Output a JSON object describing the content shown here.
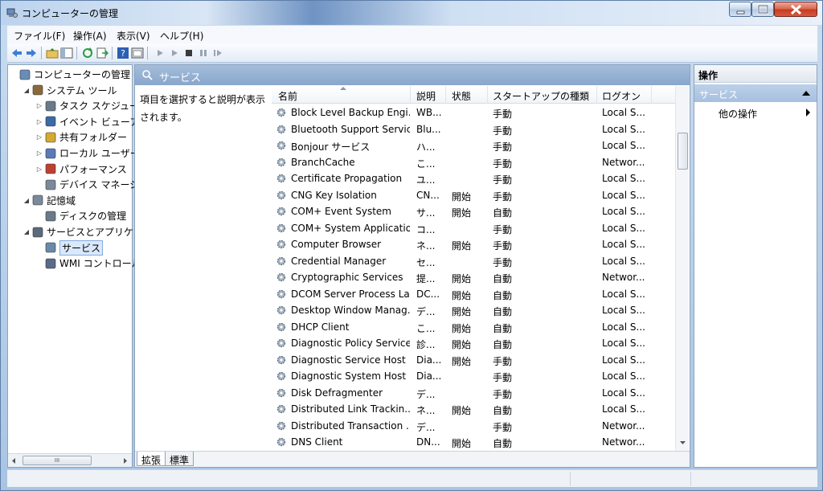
{
  "window": {
    "title": "コンピューターの管理"
  },
  "menu": [
    {
      "label": "ファイル(F)"
    },
    {
      "label": "操作(A)"
    },
    {
      "label": "表示(V)"
    },
    {
      "label": "ヘルプ(H)"
    }
  ],
  "tree": [
    {
      "label": "コンピューターの管理 (ロ",
      "icon": "computer-management-icon",
      "level": 0,
      "expander": ""
    },
    {
      "label": "システム ツール",
      "icon": "tools-icon",
      "level": 1,
      "expander": "◢"
    },
    {
      "label": "タスク スケジューラ",
      "icon": "clock-icon",
      "level": 2,
      "expander": "▷"
    },
    {
      "label": "イベント ビューアー",
      "icon": "event-viewer-icon",
      "level": 2,
      "expander": "▷"
    },
    {
      "label": "共有フォルダー",
      "icon": "shared-folder-icon",
      "level": 2,
      "expander": "▷"
    },
    {
      "label": "ローカル ユーザーと",
      "icon": "users-icon",
      "level": 2,
      "expander": "▷"
    },
    {
      "label": "パフォーマンス",
      "icon": "performance-icon",
      "level": 2,
      "expander": "▷"
    },
    {
      "label": "デバイス マネージャ",
      "icon": "device-manager-icon",
      "level": 2,
      "expander": ""
    },
    {
      "label": "記憶域",
      "icon": "storage-icon",
      "level": 1,
      "expander": "◢"
    },
    {
      "label": "ディスクの管理",
      "icon": "disk-icon",
      "level": 2,
      "expander": ""
    },
    {
      "label": "サービスとアプリケー",
      "icon": "services-apps-icon",
      "level": 1,
      "expander": "◢"
    },
    {
      "label": "サービス",
      "icon": "gear-icon",
      "level": 2,
      "expander": "",
      "selected": true
    },
    {
      "label": "WMI コントロール",
      "icon": "wmi-icon",
      "level": 2,
      "expander": ""
    }
  ],
  "center": {
    "header": "サービス",
    "description": "項目を選択すると説明が表示されます。",
    "columns": [
      "名前",
      "説明",
      "状態",
      "スタートアップの種類",
      "ログオン"
    ],
    "rows": [
      [
        "Block Level Backup Engi...",
        "WB...",
        "",
        "手動",
        "Local S..."
      ],
      [
        "Bluetooth Support Service",
        "Blu...",
        "",
        "手動",
        "Local S..."
      ],
      [
        "Bonjour サービス",
        "ハ...",
        "",
        "手動",
        "Local S..."
      ],
      [
        "BranchCache",
        "こ...",
        "",
        "手動",
        "Networ..."
      ],
      [
        "Certificate Propagation",
        "ユ...",
        "",
        "手動",
        "Local S..."
      ],
      [
        "CNG Key Isolation",
        "CN...",
        "開始",
        "手動",
        "Local S..."
      ],
      [
        "COM+ Event System",
        "サ...",
        "開始",
        "自動",
        "Local S..."
      ],
      [
        "COM+ System Application",
        "コ...",
        "",
        "手動",
        "Local S..."
      ],
      [
        "Computer Browser",
        "ネ...",
        "開始",
        "手動",
        "Local S..."
      ],
      [
        "Credential Manager",
        "セ...",
        "",
        "手動",
        "Local S..."
      ],
      [
        "Cryptographic Services",
        "提...",
        "開始",
        "自動",
        "Networ..."
      ],
      [
        "DCOM Server Process La...",
        "DC...",
        "開始",
        "自動",
        "Local S..."
      ],
      [
        "Desktop Window Manag...",
        "デ...",
        "開始",
        "自動",
        "Local S..."
      ],
      [
        "DHCP Client",
        "こ...",
        "開始",
        "自動",
        "Local S..."
      ],
      [
        "Diagnostic Policy Service",
        "診...",
        "開始",
        "自動",
        "Local S..."
      ],
      [
        "Diagnostic Service Host",
        "Dia...",
        "開始",
        "手動",
        "Local S..."
      ],
      [
        "Diagnostic System Host",
        "Dia...",
        "",
        "手動",
        "Local S..."
      ],
      [
        "Disk Defragmenter",
        "デ...",
        "",
        "手動",
        "Local S..."
      ],
      [
        "Distributed Link Trackin...",
        "ネ...",
        "開始",
        "自動",
        "Local S..."
      ],
      [
        "Distributed Transaction ...",
        "デ...",
        "",
        "手動",
        "Networ..."
      ],
      [
        "DNS Client",
        "DN...",
        "開始",
        "自動",
        "Networ..."
      ]
    ],
    "tabs": [
      "拡張",
      "標準"
    ]
  },
  "actions": {
    "header": "操作",
    "section": "サービス",
    "item": "他の操作"
  },
  "hscroll_label": "III"
}
